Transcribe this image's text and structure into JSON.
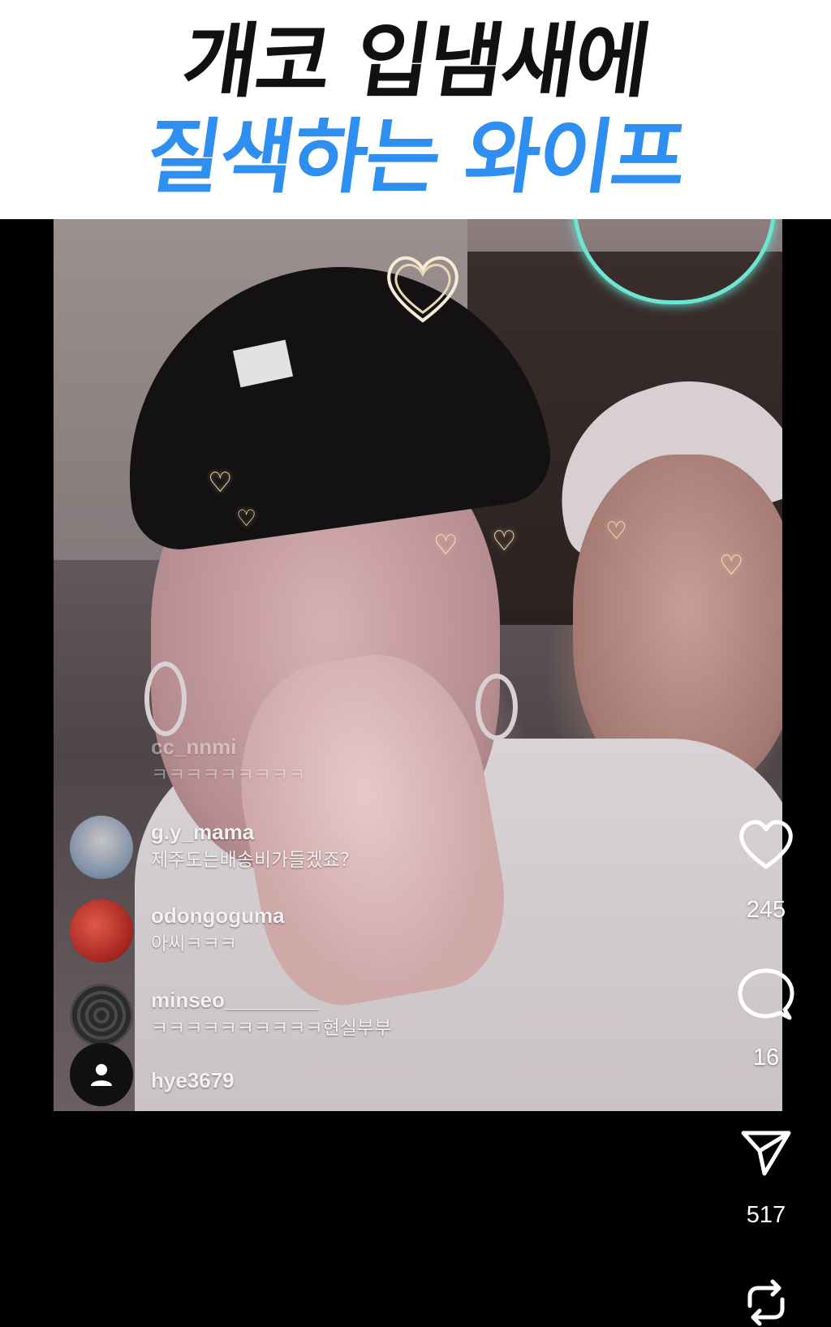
{
  "header": {
    "title_line1": "개코 입냄새에",
    "title_line2": "질색하는 와이프",
    "line1_color": "#111111",
    "line2_color": "#2e8ff0"
  },
  "live_comments": [
    {
      "username": "cc_nnmi",
      "message": "ㅋㅋㅋㅋㅋㅋㅋㅋㅋ",
      "faded": true
    },
    {
      "username": "g.y_mama",
      "message": "제주도는배송비가들겠죠?",
      "avatar": "person-on-beach"
    },
    {
      "username": "odongoguma",
      "message": "아씨ㅋㅋㅋ",
      "avatar": "red-sweet-potato"
    },
    {
      "username": "minseo________",
      "message": "ㅋㅋㅋㅋㅋㅋㅋㅋㅋㅋ현실부부",
      "avatar": "dark-pattern"
    },
    {
      "username": "hye3679",
      "message": "",
      "avatar": "default-person-icon"
    }
  ],
  "actions": {
    "like_count": "245",
    "comment_count": "16",
    "share_count": "517",
    "icons": [
      "heart-icon",
      "comment-bubble-icon",
      "send-icon",
      "repost-icon"
    ]
  }
}
